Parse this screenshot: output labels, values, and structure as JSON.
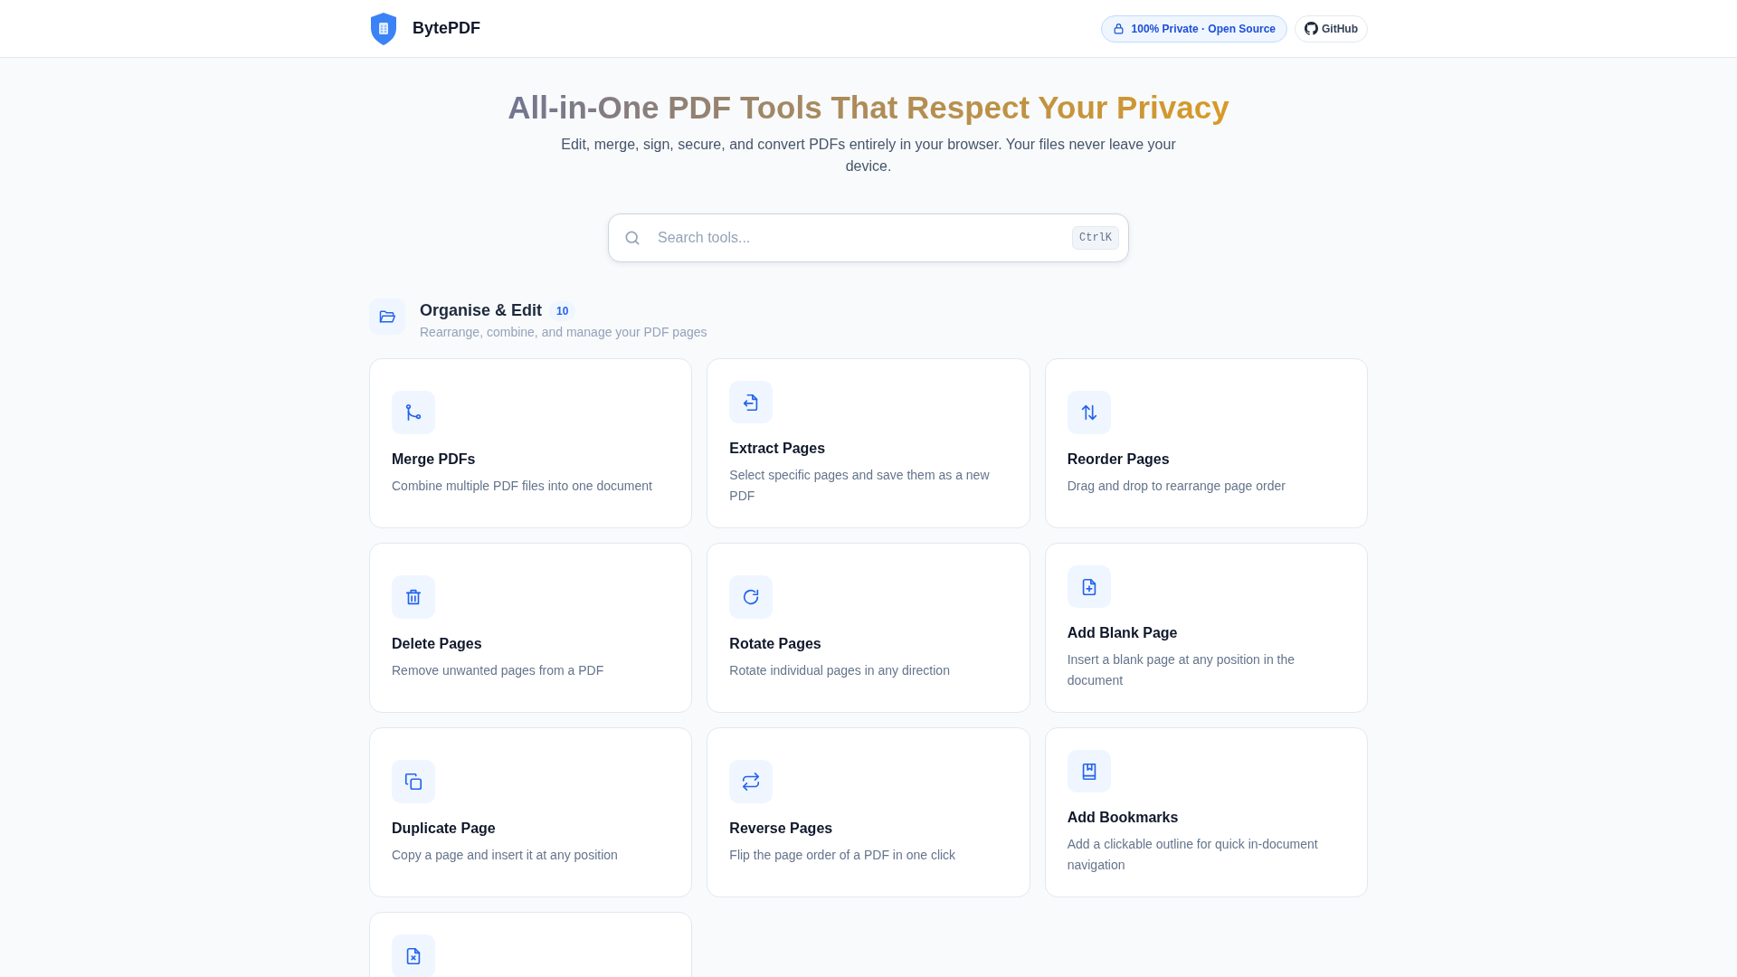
{
  "brand": {
    "name": "BytePDF"
  },
  "header_badges": [
    {
      "kind": "privacy",
      "label": "100% Private · Open Source"
    },
    {
      "kind": "github",
      "label": "GitHub"
    }
  ],
  "hero": {
    "title": "All-in-One PDF Tools That Respect Your Privacy",
    "subtitle": "Edit, merge, sign, secure, and convert PDFs entirely in your browser. Your files never leave your device."
  },
  "search": {
    "placeholder": "Search tools...",
    "shortcut": "CtrlK"
  },
  "section": {
    "title": "Organise & Edit",
    "count": "10",
    "subtitle": "Rearrange, combine, and manage your PDF pages"
  },
  "tools": [
    {
      "kind": "merge",
      "title": "Merge PDFs",
      "description": "Combine multiple PDF files into one document"
    },
    {
      "kind": "extract",
      "title": "Extract Pages",
      "description": "Select specific pages and save them as a new PDF"
    },
    {
      "kind": "reorder",
      "title": "Reorder Pages",
      "description": "Drag and drop to rearrange page order"
    },
    {
      "kind": "delete",
      "title": "Delete Pages",
      "description": "Remove unwanted pages from a PDF"
    },
    {
      "kind": "rotate",
      "title": "Rotate Pages",
      "description": "Rotate individual pages in any direction"
    },
    {
      "kind": "add",
      "title": "Add Blank Page",
      "description": "Insert a blank page at any position in the document"
    },
    {
      "kind": "duplicate",
      "title": "Duplicate Page",
      "description": "Copy a page and insert it at any position"
    },
    {
      "kind": "reverse",
      "title": "Reverse Pages",
      "description": "Flip the page order of a PDF in one click"
    },
    {
      "kind": "bookmark",
      "title": "Add Bookmarks",
      "description": "Add a clickable outline for quick in-document navigation"
    },
    {
      "kind": "remove"
    }
  ]
}
